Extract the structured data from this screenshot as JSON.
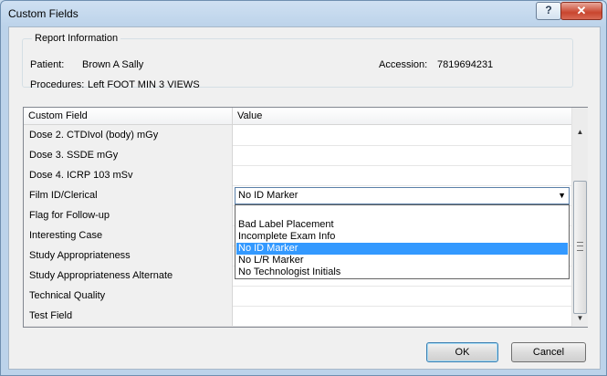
{
  "window": {
    "title": "Custom Fields",
    "help_glyph": "?",
    "close_glyph": "✕"
  },
  "report": {
    "group_label": "Report Information",
    "patient_label": "Patient:",
    "patient_value": "Brown A Sally",
    "accession_label": "Accession:",
    "accession_value": "7819694231",
    "procedures_label": "Procedures:",
    "procedures_value": "Left FOOT MIN 3 VIEWS"
  },
  "grid": {
    "columns": [
      "Custom Field",
      "Value"
    ],
    "rows": [
      "Dose 2. CTDIvol (body) mGy",
      "Dose 3. SSDE mGy",
      "Dose 4. ICRP 103 mSv",
      "Film ID/Clerical",
      "Flag for Follow-up",
      "Interesting Case",
      "Study Appropriateness",
      "Study Appropriateness Alternate",
      "Technical Quality",
      "Test Field"
    ],
    "scroll_up_glyph": "▲",
    "scroll_down_glyph": "▼"
  },
  "combo": {
    "value": "No ID Marker",
    "arrow_glyph": "▼",
    "options": [
      "",
      "Bad Label Placement",
      "Incomplete Exam Info",
      "No ID Marker",
      "No L/R Marker",
      "No Technologist Initials"
    ],
    "selected_index": 3
  },
  "buttons": {
    "ok": "OK",
    "cancel": "Cancel"
  },
  "colors": {
    "selection": "#3399ff",
    "title_close": "#c9452e"
  }
}
